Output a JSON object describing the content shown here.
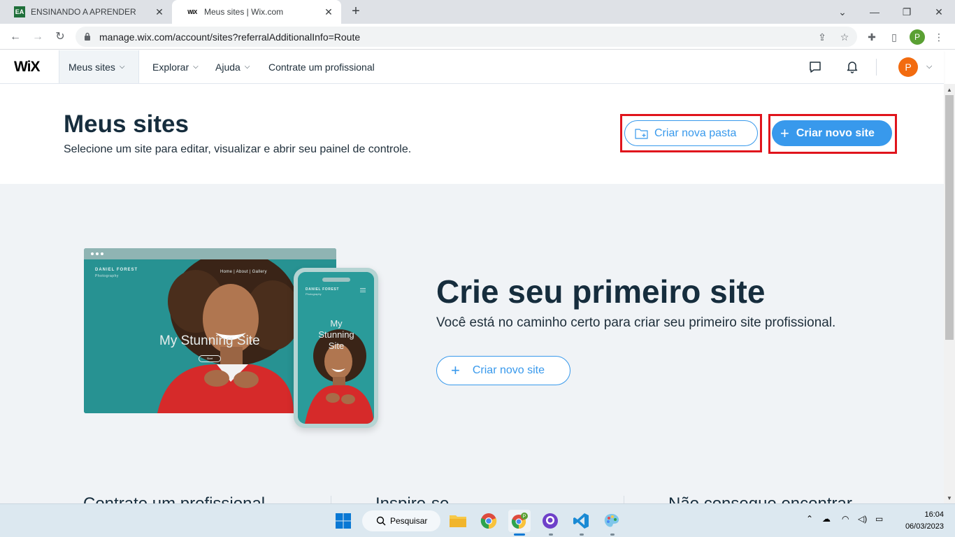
{
  "browser": {
    "tabs": [
      {
        "label": "ENSINANDO A APRENDER",
        "favicon": "ea-favicon"
      },
      {
        "label": "Meus sites | Wix.com",
        "favicon": "wix-favicon"
      }
    ],
    "favicon_text": {
      "tab1": "EA",
      "tab2": "WiX"
    },
    "url": "manage.wix.com/account/sites?referralAdditionalInfo=Route",
    "profile_initial": "P"
  },
  "wix_header": {
    "logo": "WiX",
    "nav": [
      {
        "label": "Meus sites"
      },
      {
        "label": "Explorar"
      },
      {
        "label": "Ajuda"
      },
      {
        "label": "Contrate um profissional"
      }
    ],
    "avatar_initial": "P"
  },
  "page": {
    "title": "Meus sites",
    "subtitle": "Selecione um site para editar, visualizar e abrir seu painel de controle.",
    "btn_new_folder": "Criar nova pasta",
    "btn_new_site": "Criar novo site"
  },
  "hero": {
    "title": "Crie seu primeiro site",
    "subtitle": "Você está no caminho certo para criar seu primeiro site profissional.",
    "btn_new_site": "Criar novo site",
    "mock": {
      "brand": "DANIEL FOREST",
      "brand_sub": "Photography",
      "nav": "Home  |  About  |  Gallery",
      "site_title": "My Stunning Site",
      "button": "Start"
    }
  },
  "bottom_sections": [
    {
      "label": "Contrate um profissional"
    },
    {
      "label": "Inspire-se"
    },
    {
      "label": "Não consegue encontrar"
    }
  ],
  "taskbar": {
    "search_label": "Pesquisar",
    "time": "16:04",
    "date": "06/03/2023"
  },
  "colors": {
    "accent": "#3899ec",
    "highlight": "#e0141c",
    "avatar": "#f26b0f",
    "title": "#162d3d"
  }
}
